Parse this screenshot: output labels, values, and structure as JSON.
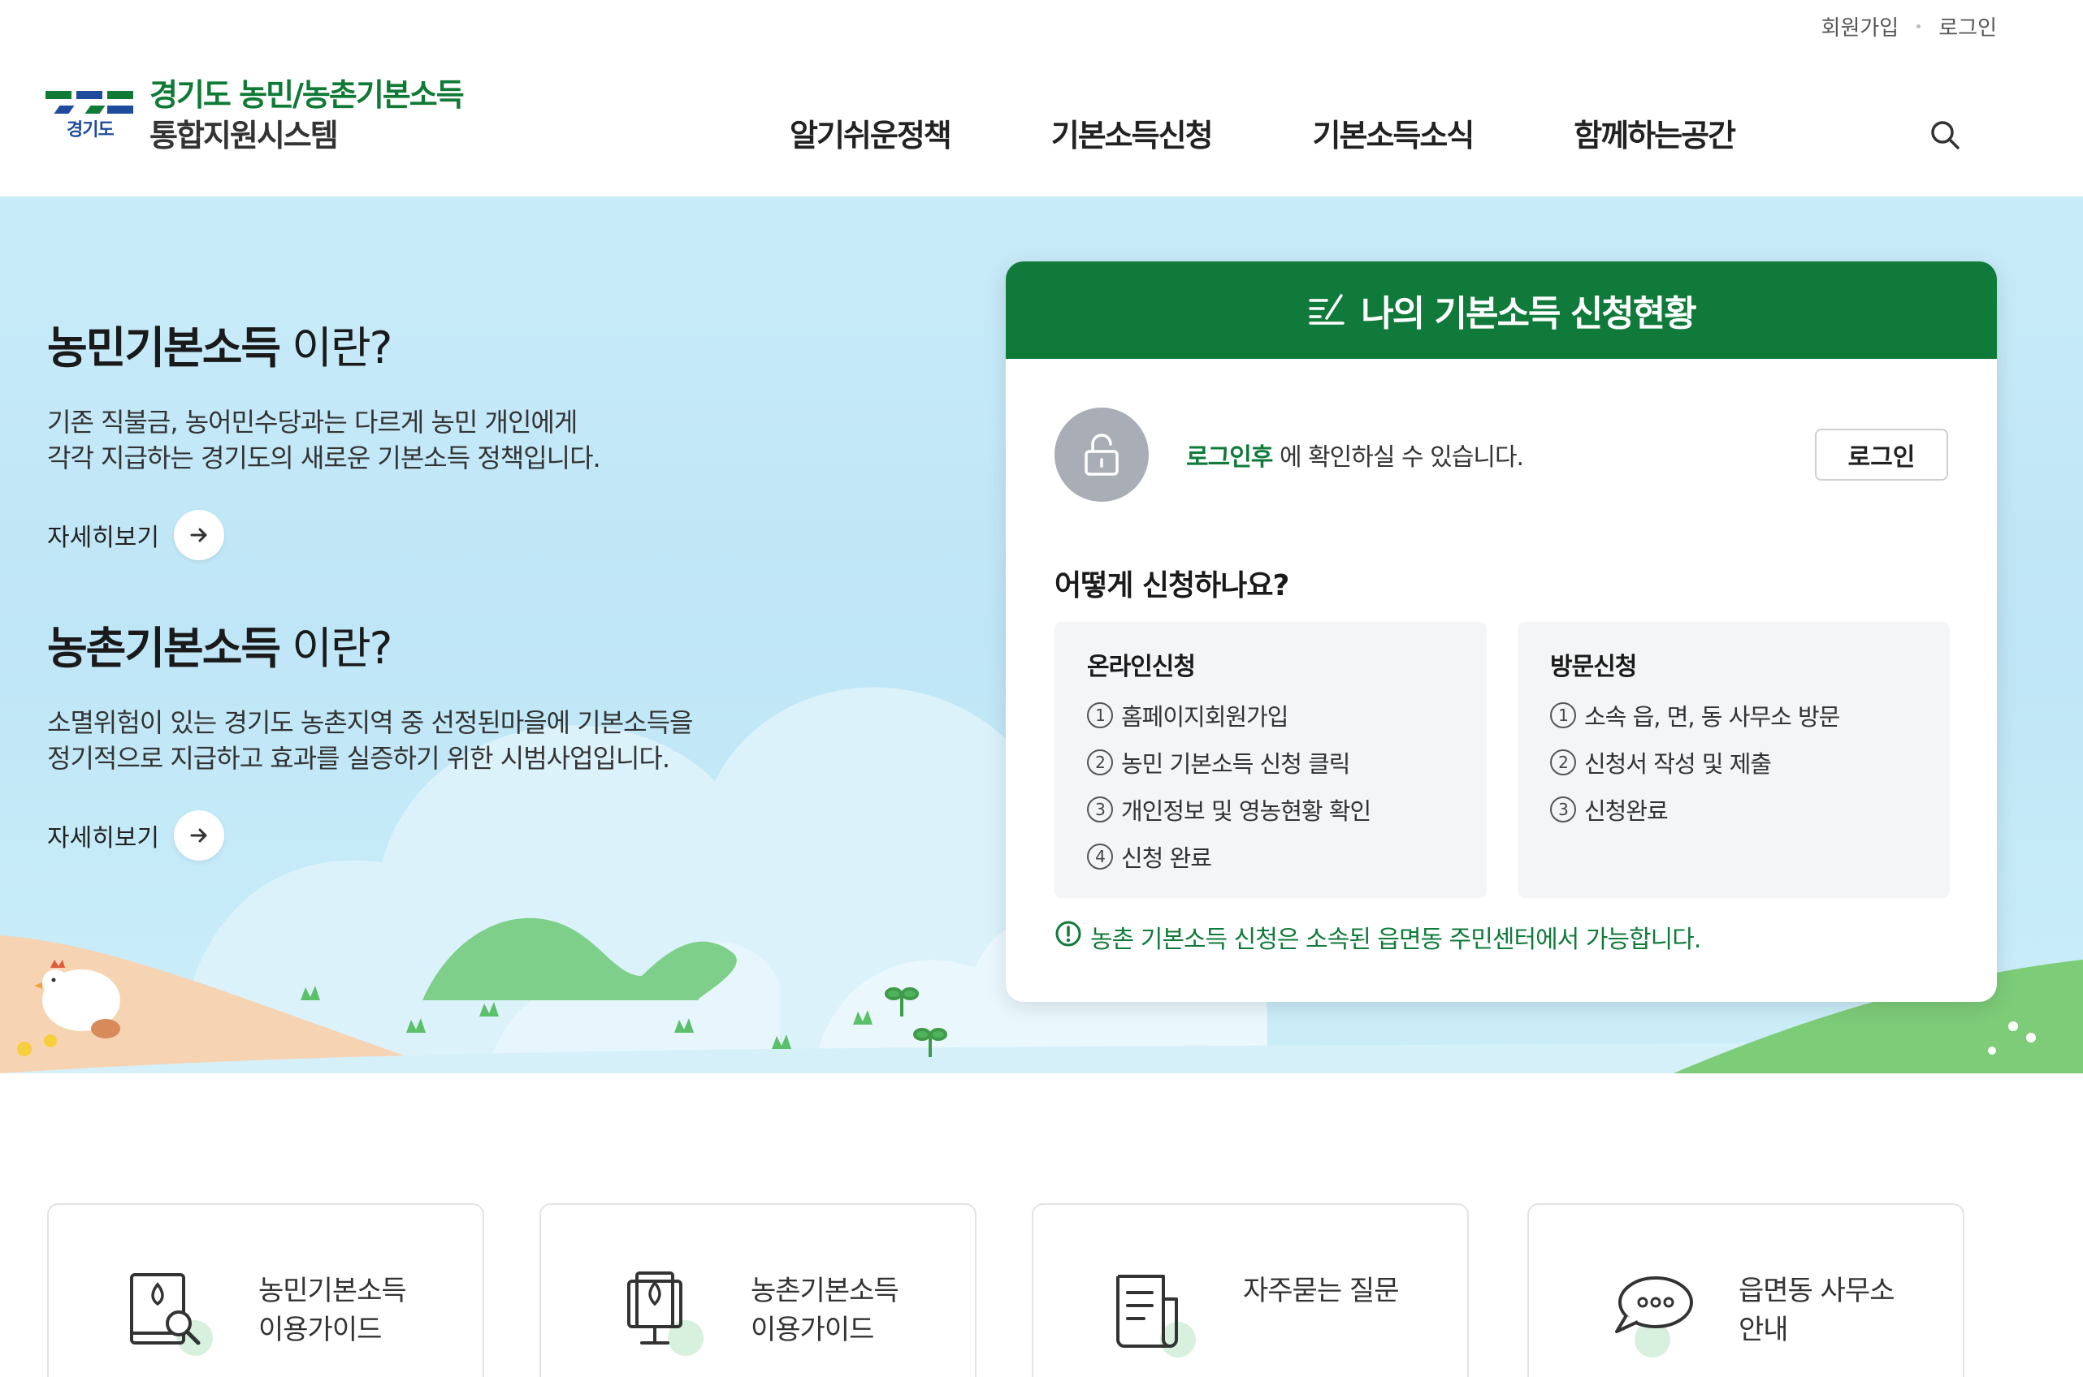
{
  "header": {
    "top_links": {
      "signup": "회원가입",
      "login": "로그인"
    },
    "logo": {
      "line1": "경기도 농민/농촌기본소득",
      "line2": "통합지원시스템",
      "emblem_text": "경기도"
    },
    "nav": [
      {
        "label": "알기쉬운정책"
      },
      {
        "label": "기본소득신청"
      },
      {
        "label": "기본소득소식"
      },
      {
        "label": "함께하는공간"
      }
    ],
    "search_icon": "search-icon"
  },
  "hero": {
    "farmer": {
      "title_bold": "농민기본소득",
      "title_light": " 이란?",
      "desc_line1": "기존 직불금, 농어민수당과는 다르게 농민 개인에게",
      "desc_line2": "각각 지급하는 경기도의 새로운 기본소득 정책입니다.",
      "more": "자세히보기"
    },
    "rural": {
      "title_bold": "농촌기본소득",
      "title_light": " 이란?",
      "desc_line1": "소멸위험이 있는 경기도 농촌지역 중 선정된마을에 기본소득을",
      "desc_line2": "정기적으로 지급하고 효과를 실증하기 위한 시범사업입니다.",
      "more": "자세히보기"
    }
  },
  "panel": {
    "title": "나의 기본소득 신청현황",
    "login_highlight": "로그인후",
    "login_msg": " 에 확인하실 수 있습니다.",
    "login_button": "로그인",
    "how_title": "어떻게 신청하나요?",
    "online": {
      "title": "온라인신청",
      "steps": [
        {
          "n": "1",
          "text": "홈페이지회원가입"
        },
        {
          "n": "2",
          "text": "농민 기본소득 신청 클릭"
        },
        {
          "n": "3",
          "text": "개인정보 및 영농현황 확인"
        },
        {
          "n": "4",
          "text": "신청 완료"
        }
      ]
    },
    "visit": {
      "title": "방문신청",
      "steps": [
        {
          "n": "1",
          "text": "소속 읍, 면, 동 사무소 방문"
        },
        {
          "n": "2",
          "text": "신청서 작성 및 제출"
        },
        {
          "n": "3",
          "text": "신청완료"
        }
      ]
    },
    "notice": "농촌 기본소득 신청은 소속된 읍면동 주민센터에서 가능합니다."
  },
  "cards": [
    {
      "line1": "농민기본소득",
      "line2": "이용가이드",
      "icon": "book-search-icon"
    },
    {
      "line1": "농촌기본소득",
      "line2": "이용가이드",
      "icon": "monitor-leaf-icon"
    },
    {
      "line1": "자주묻는 질문",
      "line2": "",
      "icon": "document-icon"
    },
    {
      "line1": "읍면동 사무소",
      "line2": "안내",
      "icon": "chat-bubble-icon"
    }
  ],
  "colors": {
    "brand_green": "#0f7a3a",
    "brand_blue": "#1e4b9c",
    "hero_sky": "#c3e8f8"
  }
}
